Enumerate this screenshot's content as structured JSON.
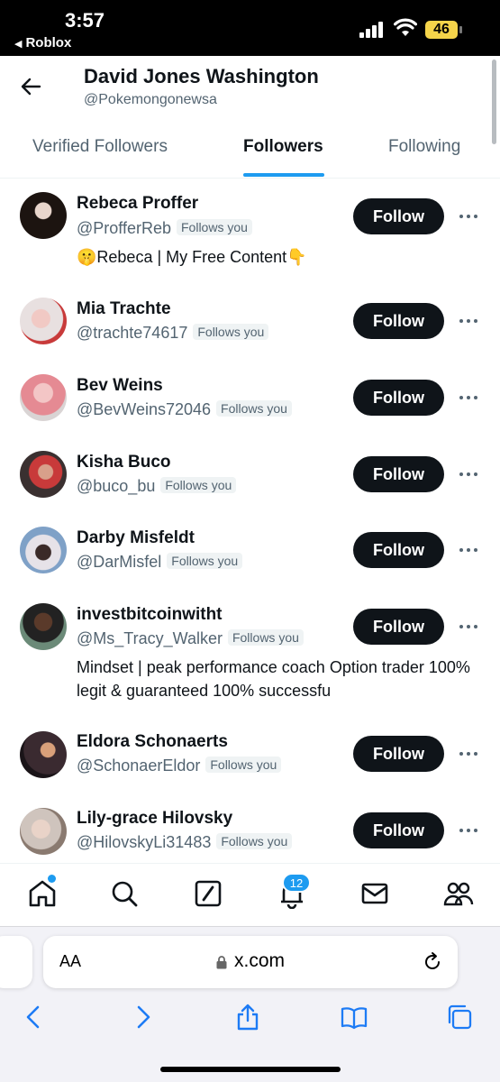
{
  "status_bar": {
    "time": "3:57",
    "back_app": "Roblox",
    "battery": "46"
  },
  "header": {
    "name": "David Jones Washington",
    "handle": "@Pokemongonewsa"
  },
  "tabs": [
    {
      "label": "Verified Followers",
      "active": false
    },
    {
      "label": "Followers",
      "active": true
    },
    {
      "label": "Following",
      "active": false
    }
  ],
  "follow_label": "Follow",
  "follows_you_label": "Follows you",
  "followers": [
    {
      "name": "Rebeca Proffer",
      "handle": "@ProfferReb",
      "follows_you": true,
      "bio": "🤫Rebeca | My Free Content👇"
    },
    {
      "name": "Mia Trachte",
      "handle": "@trachte74617",
      "follows_you": true,
      "bio": ""
    },
    {
      "name": "Bev Weins",
      "handle": "@BevWeins72046",
      "follows_you": true,
      "bio": ""
    },
    {
      "name": "Kisha Buco",
      "handle": "@buco_bu",
      "follows_you": true,
      "bio": ""
    },
    {
      "name": "Darby Misfeldt",
      "handle": "@DarMisfel",
      "follows_you": true,
      "bio": ""
    },
    {
      "name": "investbitcoinwitht",
      "handle": "@Ms_Tracy_Walker",
      "follows_you": true,
      "bio": "Mindset | peak performance coach Option trader 100% legit & guaranteed 100% successfu"
    },
    {
      "name": "Eldora Schonaerts",
      "handle": "@SchonaerEldor",
      "follows_you": true,
      "bio": ""
    },
    {
      "name": "Lily-grace Hilovsky",
      "handle": "@HilovskyLi31483",
      "follows_you": true,
      "bio": ""
    }
  ],
  "bottom_nav": {
    "items": [
      {
        "icon": "home-icon",
        "has_dot": true
      },
      {
        "icon": "search-icon"
      },
      {
        "icon": "grok-icon"
      },
      {
        "icon": "bell-icon",
        "badge": "12"
      },
      {
        "icon": "mail-icon"
      },
      {
        "icon": "communities-icon"
      }
    ]
  },
  "browser": {
    "aa_label": "AA",
    "url": "x.com"
  },
  "colors": {
    "accent": "#1d9bf0",
    "follow_button": "#0f1419",
    "battery": "#f5d44a"
  }
}
